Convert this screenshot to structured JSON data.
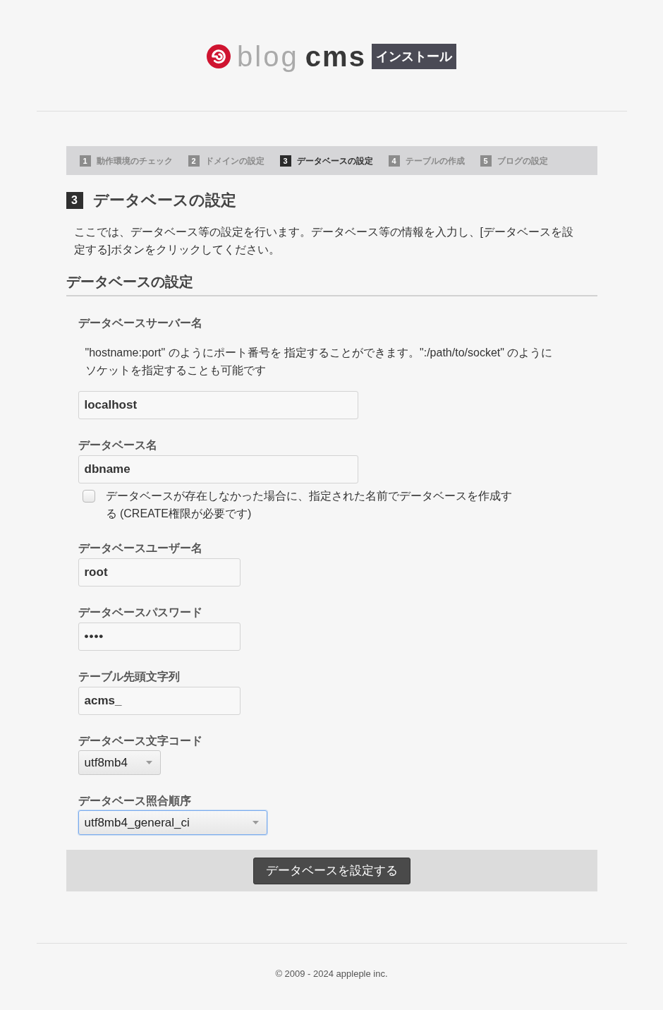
{
  "header": {
    "logo_text": "blog **cms**",
    "badge": "インストール"
  },
  "steps": [
    {
      "number": "1",
      "label": "動作環境のチェック",
      "selected": false
    },
    {
      "number": "2",
      "label": "ドメインの設定",
      "selected": false
    },
    {
      "number": "3",
      "label": "データベースの設定",
      "selected": true
    },
    {
      "number": "4",
      "label": "テーブルの作成",
      "selected": false
    },
    {
      "number": "5",
      "label": "ブログの設定",
      "selected": false
    }
  ],
  "page_heading": {
    "number": "3",
    "title": "データベースの設定"
  },
  "intro": "ここでは、データベース等の設定を行います。データベース等の情報を入力し、[データベースを設定する]ボタンをクリックしてください。",
  "section": {
    "title": "データベースの設定",
    "fields": [
      {
        "kind": "text",
        "label": "データベースサーバー名",
        "help": "\"hostname:port\" のようにポート番号を 指定することができます。\":/path/to/socket\" のようにソケットを指定することも可能です",
        "value": "localhost"
      },
      {
        "kind": "text",
        "label": "データベース名",
        "value": "dbname",
        "option": {
          "label": "データベースが存在しなかった場合に、指定された名前でデータベースを作成する (CREATE権限が必要です)",
          "checked": false
        }
      },
      {
        "kind": "text",
        "label": "データベースユーザー名",
        "value": "root"
      },
      {
        "kind": "password",
        "label": "データベースパスワード",
        "value": "••••"
      },
      {
        "kind": "text",
        "label": "テーブル先頭文字列",
        "value": "acms_"
      },
      {
        "kind": "select",
        "label": "データベース文字コード",
        "value": "utf8mb4",
        "focused": false
      },
      {
        "kind": "select",
        "label": "データベース照合順序",
        "value": "utf8mb4_general_ci",
        "focused": true
      }
    ],
    "submit": "データベースを設定する"
  },
  "footer": {
    "copyright": "© 2009 - 2024 appleple inc."
  }
}
